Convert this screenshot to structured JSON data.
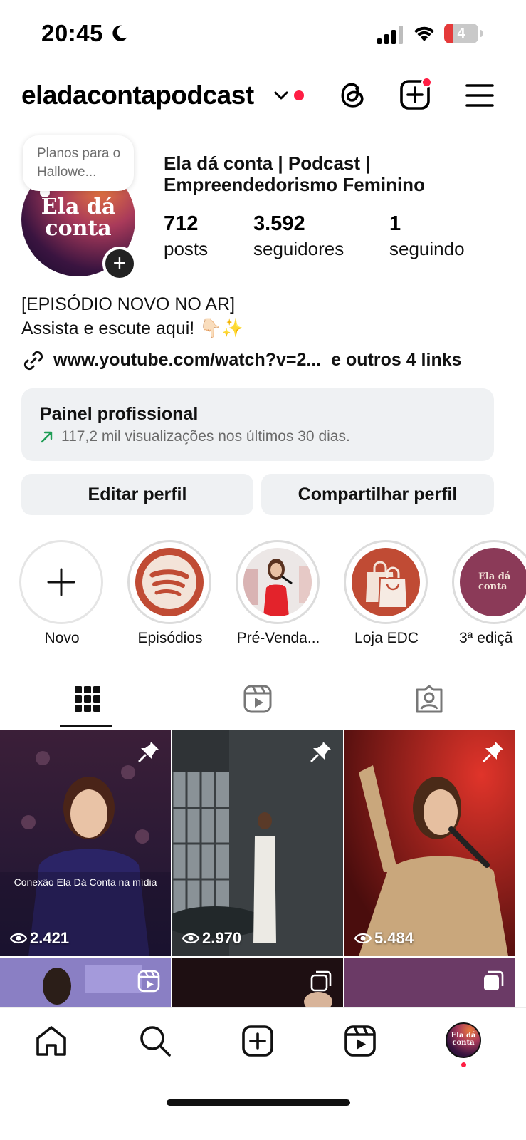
{
  "status": {
    "time": "20:45",
    "battery": "4",
    "battery_level_percent": 4
  },
  "header": {
    "username": "eladacontapodcast"
  },
  "profile": {
    "note": "Planos para o Hallowe...",
    "display_name": "Ela dá conta | Podcast | Empreendedorismo Feminino",
    "avatar_text": "Ela dá conta",
    "stats": [
      {
        "value": "712",
        "label": "posts"
      },
      {
        "value": "3.592",
        "label": "seguidores"
      },
      {
        "value": "1",
        "label": "seguindo"
      }
    ],
    "bio_line1": "[EPISÓDIO NOVO NO AR]",
    "bio_line2": "Assista e escute aqui! 👇🏻✨",
    "link": "www.youtube.com/watch?v=2...",
    "more_links": "e outros 4 links"
  },
  "dashboard": {
    "title": "Painel profissional",
    "subtitle": "117,2 mil visualizações nos últimos 30 dias."
  },
  "buttons": {
    "edit": "Editar perfil",
    "share": "Compartilhar perfil"
  },
  "highlights": [
    {
      "label": "Novo"
    },
    {
      "label": "Episódios"
    },
    {
      "label": "Pré-Venda..."
    },
    {
      "label": "Loja EDC"
    },
    {
      "label": "3ª ediçã"
    }
  ],
  "posts": [
    {
      "views": "2.421",
      "caption": "Conexão Ela Dá Conta na mídia"
    },
    {
      "views": "2.970"
    },
    {
      "views": "5.484"
    }
  ],
  "colors": {
    "accent_red": "#ff1e44",
    "button_bg": "#eff1f3",
    "trend_green": "#1f9d55"
  }
}
